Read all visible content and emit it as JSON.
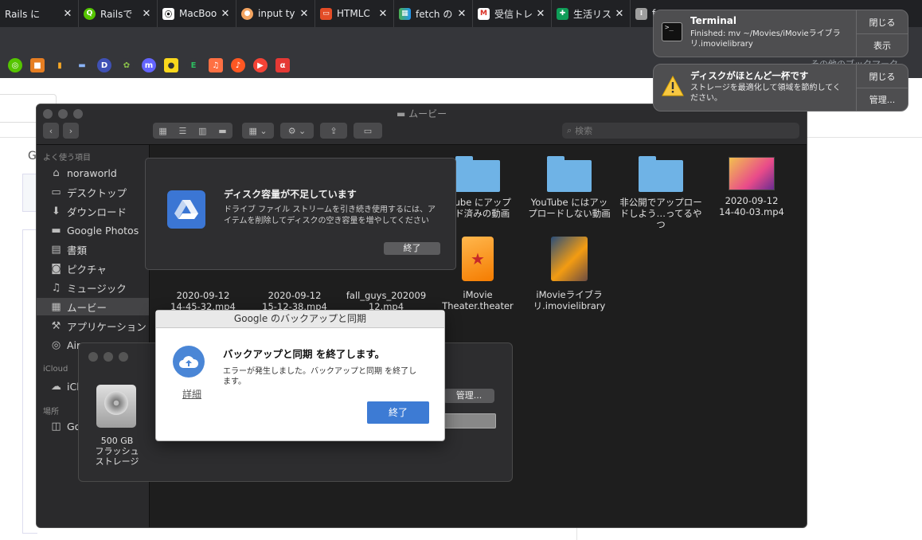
{
  "browser": {
    "tabs": [
      {
        "label": "Rails に",
        "favicon": "rails-tab-icon",
        "color": "#cc0000"
      },
      {
        "label": "Railsで",
        "favicon": "qiita-icon",
        "color": "#55c500"
      },
      {
        "label": "MacBoo",
        "favicon": "github-icon",
        "color": "#ffffff"
      },
      {
        "label": "input ty",
        "favicon": "web-icon",
        "color": "#f4a460"
      },
      {
        "label": "HTMLC",
        "favicon": "html-icon",
        "color": "#e34c26"
      },
      {
        "label": "fetch の",
        "favicon": "sheet-icon",
        "color": "#3c8d40"
      },
      {
        "label": "受信トレ",
        "favicon": "gmail-icon",
        "color": "#d93025"
      },
      {
        "label": "生活リス",
        "favicon": "sheets-icon",
        "color": "#0f9d58"
      },
      {
        "label": "fo",
        "favicon": "doc-icon",
        "color": "#9e9e9e"
      }
    ],
    "bookmarks_other": "その他のブックマーク",
    "bookmark_icons": [
      {
        "name": "bookmark-icon-1",
        "color": "#55c500",
        "glyph": "◎"
      },
      {
        "name": "bookmark-icon-2",
        "color": "#e67e22",
        "glyph": "■"
      },
      {
        "name": "bookmark-icon-3",
        "color": "#f9a825",
        "glyph": "▮"
      },
      {
        "name": "bookmark-icon-4",
        "color": "#4a7bd0",
        "glyph": "▬"
      },
      {
        "name": "bookmark-icon-5",
        "color": "#3f51b5",
        "glyph": "D"
      },
      {
        "name": "bookmark-icon-6",
        "color": "#8bc34a",
        "glyph": "✿"
      },
      {
        "name": "bookmark-icon-7",
        "color": "#6364ff",
        "glyph": "m"
      },
      {
        "name": "bookmark-icon-8",
        "color": "#f9d71c",
        "glyph": "●"
      },
      {
        "name": "bookmark-icon-9",
        "color": "#2dbe60",
        "glyph": "E"
      },
      {
        "name": "bookmark-icon-10",
        "color": "#ff7043",
        "glyph": "♫"
      },
      {
        "name": "bookmark-icon-11",
        "color": "#ff5722",
        "glyph": "♪"
      },
      {
        "name": "bookmark-icon-12",
        "color": "#f44336",
        "glyph": "▶"
      },
      {
        "name": "bookmark-icon-13",
        "color": "#e53935",
        "glyph": "α"
      }
    ]
  },
  "finder": {
    "title": "ムービー",
    "search_placeholder": "検索",
    "sidebar": {
      "favorites_header": "よく使う項目",
      "items": [
        {
          "label": "noraworld",
          "icon": "home-icon",
          "glyph": "⌂"
        },
        {
          "label": "デスクトップ",
          "icon": "desktop-icon",
          "glyph": "▭"
        },
        {
          "label": "ダウンロード",
          "icon": "download-icon",
          "glyph": "⬇"
        },
        {
          "label": "Google Photos",
          "icon": "folder-icon",
          "glyph": "▬"
        },
        {
          "label": "書類",
          "icon": "documents-icon",
          "glyph": "▤"
        },
        {
          "label": "ピクチャ",
          "icon": "pictures-icon",
          "glyph": "◙"
        },
        {
          "label": "ミュージック",
          "icon": "music-icon",
          "glyph": "♫"
        },
        {
          "label": "ムービー",
          "icon": "movies-icon",
          "glyph": "▦"
        },
        {
          "label": "アプリケーション",
          "icon": "applications-icon",
          "glyph": "⚒"
        },
        {
          "label": "Air",
          "icon": "airdrop-icon",
          "glyph": "◎"
        }
      ],
      "icloud_header": "iCloud",
      "icloud_item": "iCl",
      "locations_header": "場所",
      "locations_item": "Go"
    },
    "files": [
      {
        "line1": "uTube にアップ",
        "line2": "ード済みの動画",
        "kind": "folder"
      },
      {
        "line1": "YouTube にはアッ",
        "line2": "プロードしない動画",
        "kind": "folder"
      },
      {
        "line1": "非公開でアップロー",
        "line2": "ドしよう…ってるやつ",
        "kind": "folder"
      },
      {
        "line1": "2020-09-12",
        "line2": "14-40-03.mp4",
        "kind": "video"
      },
      {
        "line1": "2020-09-12",
        "line2": "14-45-32.mp4",
        "kind": "video"
      },
      {
        "line1": "2020-09-12",
        "line2": "15-12-38.mp4",
        "kind": "video"
      },
      {
        "line1": "fall_guys_202009",
        "line2": "12.mp4",
        "kind": "video"
      },
      {
        "line1": "iMovie",
        "line2": "Theater.theater",
        "kind": "theater"
      },
      {
        "line1": "iMovieライブラ",
        "line2": "リ.imovielibrary",
        "kind": "library"
      }
    ]
  },
  "disk_window": {
    "disk_label_1": "500 GB",
    "disk_label_2": "フラッシュ",
    "disk_label_3": "ストレージ",
    "manage_button": "管理..."
  },
  "drive_dialog": {
    "title": "ディスク容量が不足しています",
    "message": "ドライブ ファイル ストリームを引き続き使用するには、アイテムを削除してディスクの空き容量を増やしてください",
    "quit_button": "終了"
  },
  "backup_dialog": {
    "window_title": "Google のバックアップと同期",
    "heading": "バックアップと同期 を終了します。",
    "message": "エラーが発生しました。バックアップと同期 を終了します。",
    "details_link": "詳細",
    "quit_button": "終了"
  },
  "notifications": {
    "terminal": {
      "app": "Terminal",
      "body": "Finished: mv ~/Movies/iMovieライブラリ.imovielibrary /Volumes/GoogleDrive...",
      "close_button": "閉じる",
      "show_button": "表示"
    },
    "disk": {
      "title": "ディスクがほとんど一杯です",
      "body": "ストレージを最適化して領域を節約してください。",
      "close_button": "閉じる",
      "manage_button": "管理..."
    }
  },
  "colors": {
    "accent_blue": "#3d7bd4",
    "folder_blue": "#6fb3e6"
  }
}
